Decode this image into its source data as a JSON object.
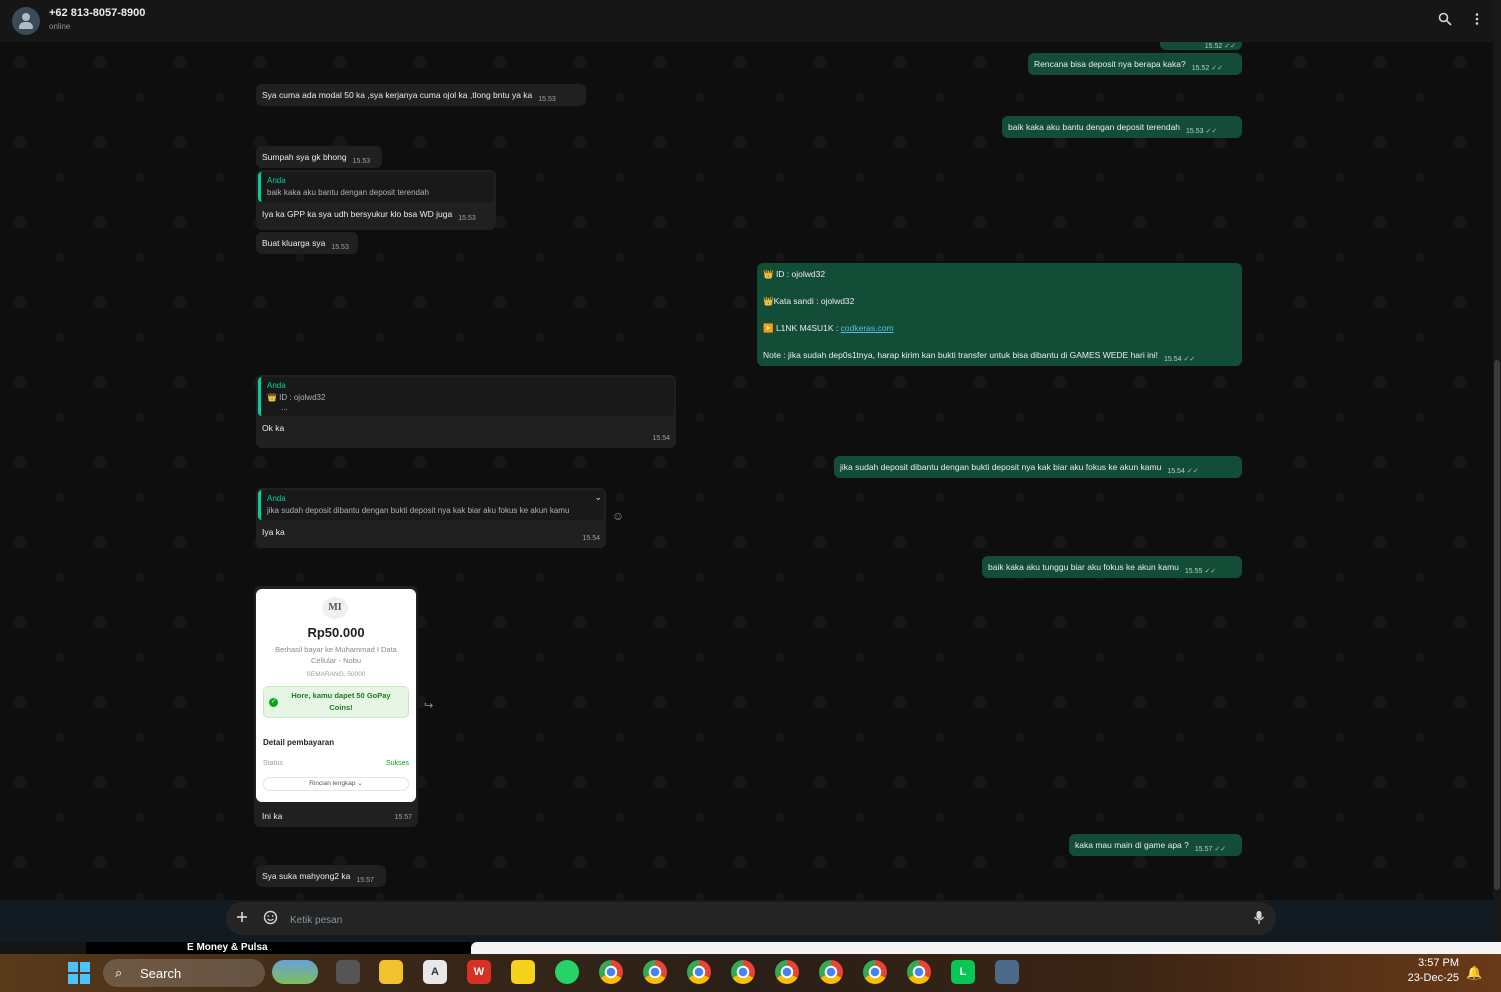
{
  "header": {
    "contact_name": "+62 813-8057-8900",
    "status": "online",
    "search_icon": "search-icon",
    "menu_icon": "more-vertical-icon"
  },
  "messages": {
    "m0": {
      "time": "15.52"
    },
    "m1": {
      "text": "Rencana bisa deposit nya berapa kaka?",
      "time": "15.52"
    },
    "m2": {
      "text": "Sya cuma ada modal 50 ka ,sya kerjanya cuma ojol ka ,tlong bntu ya ka",
      "time": "15.53"
    },
    "m3": {
      "text": "baik kaka aku bantu dengan deposit terendah",
      "time": "15.53"
    },
    "m4": {
      "text": "Sumpah sya gk bhong",
      "time": "15.53"
    },
    "m5": {
      "quote_author": "Anda",
      "quote_text": "baik kaka aku bantu dengan deposit terendah",
      "text": "Iya ka GPP ka sya udh bersyukur klo bsa WD juga",
      "time": "15.53"
    },
    "m6": {
      "text": "Buat kluarga sya",
      "time": "15.53"
    },
    "m7": {
      "line1": "👑 ID :  ojolwd32",
      "line2": "👑Kata sandi : ojolwd32",
      "line3_prefix": "▶️ L1NK M4SU1K : ",
      "link": "codkeras.com",
      "line4": "Note : jika sudah dep0s1tnya, harap kirim kan bukti transfer untuk bisa dibantu di GAMES WEDE hari ini!",
      "time": "15.54"
    },
    "m8": {
      "quote_author": "Anda",
      "quote_text": "👑 ID :  ojolwd32",
      "quote_more": "...",
      "text": "Ok ka",
      "time": "15.54"
    },
    "m9": {
      "text": "jika sudah deposit dibantu dengan bukti deposit nya kak biar aku fokus ke akun kamu",
      "time": "15.54"
    },
    "m10": {
      "quote_author": "Anda",
      "quote_text": "jika sudah deposit dibantu dengan bukti deposit nya kak biar aku fokus ke akun kamu",
      "text": "Iya ka",
      "time": "15.54"
    },
    "m11": {
      "text": "baik kaka aku tunggu biar aku fokus ke akun kamu",
      "time": "15.55"
    },
    "m12": {
      "receipt": {
        "logo": "MI",
        "amount": "Rp50.000",
        "description": "Berhasil bayar ke Muhammad I Data Cellular - Nobu",
        "location": "SEMARANG, 50000",
        "promo": "Hore, kamu dapet 50 GoPay Coins!",
        "detail_title": "Detail pembayaran",
        "status_label": "Status",
        "status_value": "Sukses",
        "more_label": "Rincian lengkap ⌄"
      },
      "text": "Ini ka",
      "time": "15.57"
    },
    "m13": {
      "text": "kaka mau main di game apa ?",
      "time": "15.57"
    },
    "m14": {
      "text": "Sya suka mahyong2 ka",
      "time": "15.57"
    }
  },
  "composer": {
    "placeholder": "Ketik pesan"
  },
  "background_strip": {
    "text": "E Money & Pulsa"
  },
  "taskbar": {
    "search_label": "Search",
    "time": "3:57 PM",
    "date": "23-Dec-25"
  },
  "colors": {
    "outgoing_bubble": "#144d37",
    "incoming_bubble": "#202020",
    "accent": "#06cf9c",
    "link": "#53bdeb"
  }
}
